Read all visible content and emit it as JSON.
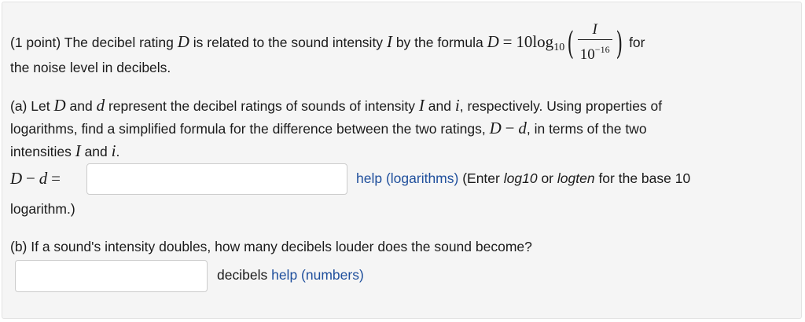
{
  "problem": {
    "points": "(1 point)",
    "intro_pre": "The decibel rating",
    "var_D": "D",
    "intro_mid": "is related to the sound intensity",
    "var_I": "I",
    "intro_post": "by the formula",
    "formula": {
      "lhs": "D",
      "eq": "=",
      "coef": "10",
      "log": "log",
      "base": "10",
      "numerator": "I",
      "den_base": "10",
      "den_exp": "−16"
    },
    "for_text": "for",
    "line2": "the noise level in decibels."
  },
  "part_a": {
    "t1": "(a) Let",
    "D": "D",
    "t2": "and",
    "d": "d",
    "t3": "represent the decibel ratings of sounds of intensity",
    "I": "I",
    "t4": "and",
    "i": "i",
    "t5": ", respectively. Using properties of",
    "line2": "logarithms, find a simplified formula for the difference between the two ratings,",
    "diff_D": "D",
    "minus": "−",
    "diff_d": "d",
    "line2_end": ", in terms of the two",
    "line3_pre": "intensities",
    "line3_I": "I",
    "line3_and": "and",
    "line3_i": "i",
    "line3_end": ".",
    "answer_label_D": "D",
    "answer_label_minus": "−",
    "answer_label_d": "d",
    "answer_label_eq": "=",
    "answer_value": "",
    "help_link": "help (logarithms)",
    "enter_pre": "(Enter",
    "log10": "log10",
    "or": "or",
    "logten": "logten",
    "enter_post": "for the base 10",
    "line5": "logarithm.)"
  },
  "part_b": {
    "question": "(b) If a sound's intensity doubles, how many decibels louder does the sound become?",
    "answer_value": "",
    "unit": "decibels",
    "help_link": "help (numbers)"
  }
}
